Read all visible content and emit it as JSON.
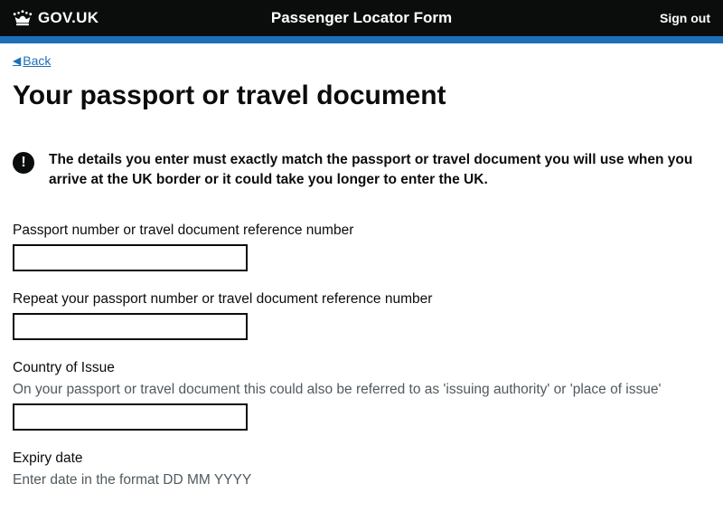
{
  "header": {
    "logo_text": "GOV.UK",
    "service_name": "Passenger Locator Form",
    "sign_out": "Sign out"
  },
  "nav": {
    "back": "Back"
  },
  "page": {
    "title": "Your passport or travel document",
    "warning_text": "The details you enter must exactly match the passport or travel document you will use when you arrive at the UK border or it could take you longer to enter the UK."
  },
  "form": {
    "passport_number_label": "Passport number or travel document reference number",
    "passport_number_value": "",
    "repeat_number_label": "Repeat your passport number or travel document reference number",
    "repeat_number_value": "",
    "country_label": "Country of Issue",
    "country_hint": "On your passport or travel document this could also be referred to as 'issuing authority' or 'place of issue'",
    "country_value": "",
    "expiry_label": "Expiry date",
    "expiry_hint": "Enter date in the format DD MM YYYY"
  }
}
